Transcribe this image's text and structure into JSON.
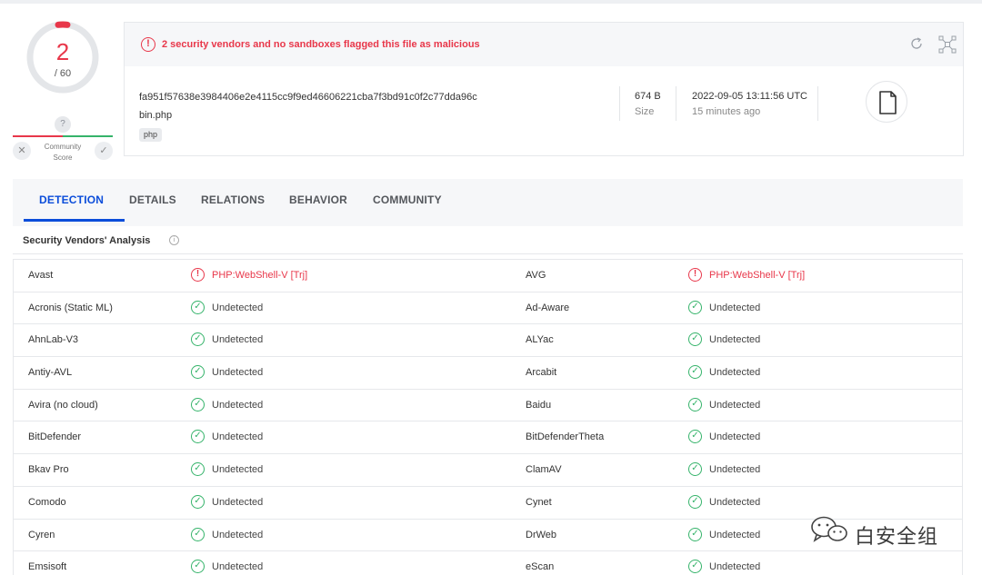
{
  "score": {
    "detections": "2",
    "total": "/ 60"
  },
  "community": {
    "question": "?",
    "label_line1": "Community",
    "label_line2": "Score",
    "dislike": "✕",
    "like": "✓"
  },
  "alert": {
    "text": "2 security vendors and no sandboxes flagged this file as malicious"
  },
  "file": {
    "hash": "fa951f57638e3984406e2e4115cc9f9ed46606221cba7f3bd91c0f2c77dda96c",
    "name": "bin.php",
    "tag": "php",
    "size_value": "674 B",
    "size_label": "Size",
    "date_value": "2022-09-05 13:11:56 UTC",
    "date_label": "15 minutes ago"
  },
  "tabs": [
    "DETECTION",
    "DETAILS",
    "RELATIONS",
    "BEHAVIOR",
    "COMMUNITY"
  ],
  "section": {
    "title": "Security Vendors' Analysis"
  },
  "colors": {
    "malicious": "#e8374a",
    "clean": "#35b36a",
    "accent": "#0b4dda"
  },
  "vendors": [
    [
      {
        "name": "Avast",
        "result": "PHP:WebShell-V [Trj]",
        "status": "malicious"
      },
      {
        "name": "AVG",
        "result": "PHP:WebShell-V [Trj]",
        "status": "malicious"
      }
    ],
    [
      {
        "name": "Acronis (Static ML)",
        "result": "Undetected",
        "status": "clean"
      },
      {
        "name": "Ad-Aware",
        "result": "Undetected",
        "status": "clean"
      }
    ],
    [
      {
        "name": "AhnLab-V3",
        "result": "Undetected",
        "status": "clean"
      },
      {
        "name": "ALYac",
        "result": "Undetected",
        "status": "clean"
      }
    ],
    [
      {
        "name": "Antiy-AVL",
        "result": "Undetected",
        "status": "clean"
      },
      {
        "name": "Arcabit",
        "result": "Undetected",
        "status": "clean"
      }
    ],
    [
      {
        "name": "Avira (no cloud)",
        "result": "Undetected",
        "status": "clean"
      },
      {
        "name": "Baidu",
        "result": "Undetected",
        "status": "clean"
      }
    ],
    [
      {
        "name": "BitDefender",
        "result": "Undetected",
        "status": "clean"
      },
      {
        "name": "BitDefenderTheta",
        "result": "Undetected",
        "status": "clean"
      }
    ],
    [
      {
        "name": "Bkav Pro",
        "result": "Undetected",
        "status": "clean"
      },
      {
        "name": "ClamAV",
        "result": "Undetected",
        "status": "clean"
      }
    ],
    [
      {
        "name": "Comodo",
        "result": "Undetected",
        "status": "clean"
      },
      {
        "name": "Cynet",
        "result": "Undetected",
        "status": "clean"
      }
    ],
    [
      {
        "name": "Cyren",
        "result": "Undetected",
        "status": "clean"
      },
      {
        "name": "DrWeb",
        "result": "Undetected",
        "status": "clean"
      }
    ],
    [
      {
        "name": "Emsisoft",
        "result": "Undetected",
        "status": "clean"
      },
      {
        "name": "eScan",
        "result": "Undetected",
        "status": "clean"
      }
    ]
  ],
  "watermark": {
    "text": "白安全组",
    "icon": "wechat-icon"
  }
}
